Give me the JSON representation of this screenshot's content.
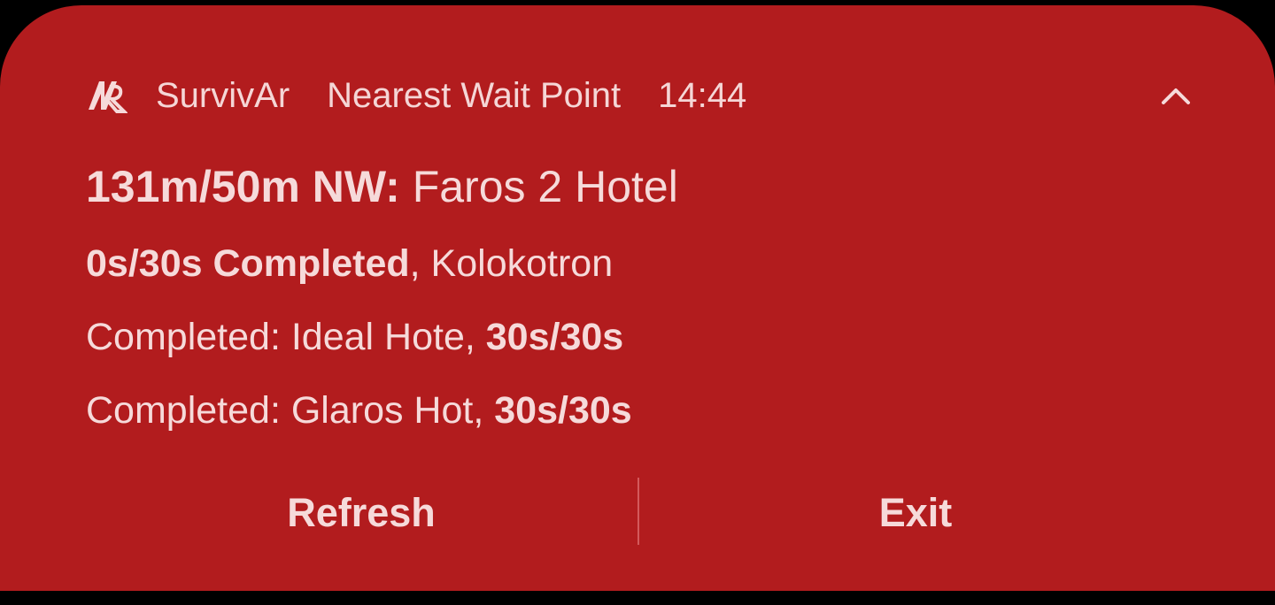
{
  "notification": {
    "app_icon": "survivar-logo-icon",
    "app_name": "SurvivAr",
    "title": "Nearest Wait Point",
    "time": "14:44",
    "expand_icon": "chevron-up-icon",
    "lines": [
      {
        "bold": "131m/50m NW:",
        "normal": " Faros 2 Hotel"
      },
      {
        "bold": "0s/30s Completed",
        "normal": ", Kolokotron"
      },
      {
        "normal": "Completed: Ideal Hote, ",
        "bold": "30s/30s"
      },
      {
        "normal": "Completed: Glaros Hot, ",
        "bold": "30s/30s"
      }
    ],
    "actions": {
      "refresh_label": "Refresh",
      "exit_label": "Exit"
    }
  },
  "colors": {
    "background": "#b21c1e",
    "text": "#f6dada"
  }
}
